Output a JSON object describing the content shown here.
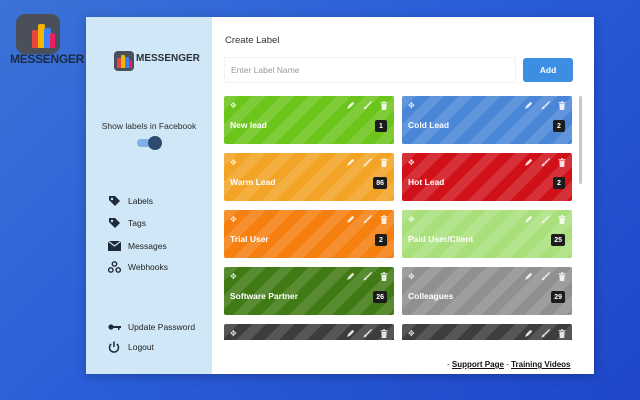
{
  "brand": {
    "corner_word": "MESSENGER",
    "sidebar_word": "MESSENGER",
    "colors": [
      "#e8453c",
      "#f4b400",
      "#3b82f6",
      "#e91e63"
    ]
  },
  "sidebar": {
    "show_labels_text": "Show labels in Facebook",
    "toggle_on": true,
    "nav": [
      {
        "label": "Labels",
        "icon": "tag-icon"
      },
      {
        "label": "Tags",
        "icon": "tag-icon"
      },
      {
        "label": "Messages",
        "icon": "envelope-icon"
      },
      {
        "label": "Webhooks",
        "icon": "webhook-icon"
      }
    ],
    "bottom": [
      {
        "label": "Update Password",
        "icon": "key-icon"
      },
      {
        "label": "Logout",
        "icon": "power-icon"
      }
    ]
  },
  "main": {
    "title": "Create Label",
    "input_placeholder": "Enter Label Name",
    "add_label": "Add",
    "labels": [
      {
        "name": "New lead",
        "count": "1",
        "color": "#6cc51a"
      },
      {
        "name": "Cold Lead",
        "count": "2",
        "color": "#4a86d8"
      },
      {
        "name": "Warm Lead",
        "count": "86",
        "color": "#f3a325"
      },
      {
        "name": "Hot Lead",
        "count": "2",
        "color": "#d0111a"
      },
      {
        "name": "Trial User",
        "count": "2",
        "color": "#f58010"
      },
      {
        "name": "Paid User/Client",
        "count": "25",
        "color": "#a9e07c"
      },
      {
        "name": "Software Partner",
        "count": "26",
        "color": "#3f7a14"
      },
      {
        "name": "Colleagues",
        "count": "29",
        "color": "#909090"
      },
      {
        "name": "",
        "count": "",
        "color": "#3d3d3d"
      },
      {
        "name": "",
        "count": "",
        "color": "#3d3d3d"
      }
    ]
  },
  "footer": {
    "sep1": "-",
    "support": "Support Page",
    "sep2": "-",
    "training": "Training Videos"
  }
}
